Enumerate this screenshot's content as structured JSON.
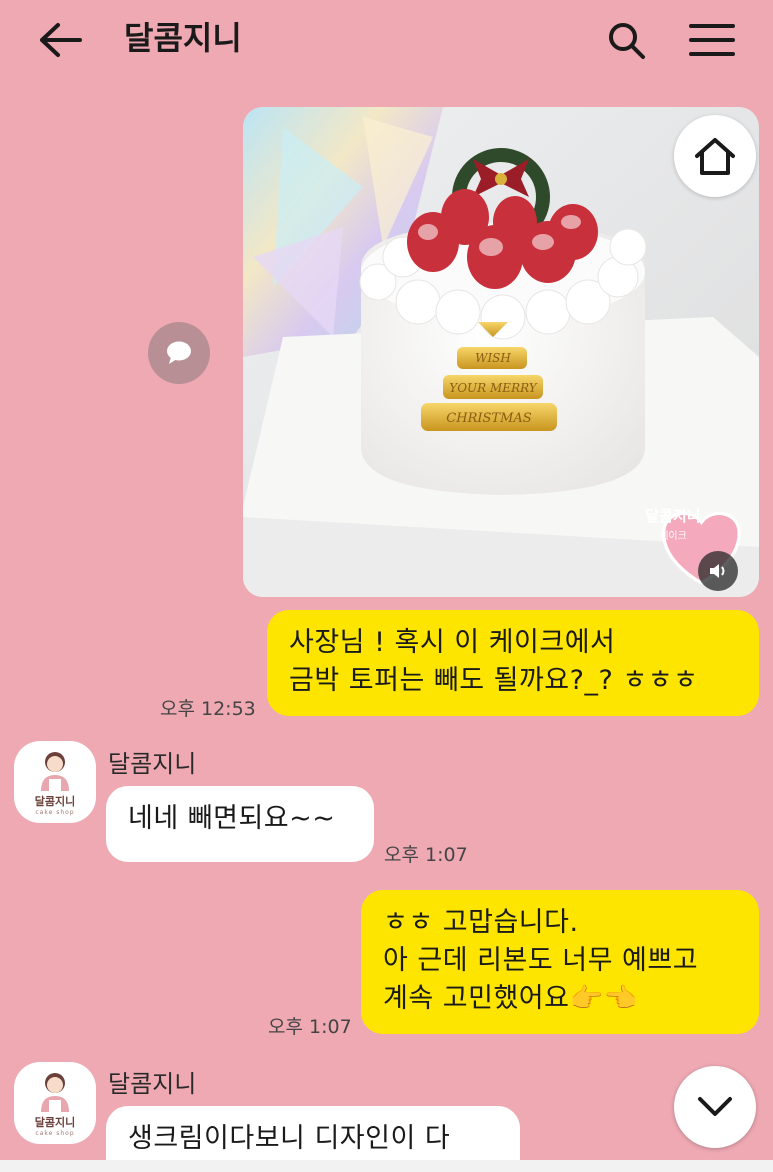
{
  "header": {
    "title": "달콤지니",
    "back_icon": "arrow-left-icon",
    "search_icon": "search-icon",
    "menu_icon": "hamburger-menu-icon"
  },
  "photo": {
    "topper_text": "WISH YOUR MERRY CHRISTMAS",
    "sticker_brand": "달콤지니",
    "sticker_sub": "케이크"
  },
  "messages": [
    {
      "from": "me",
      "text": "사장님 ! 혹시 이 케이크에서\n금박 토퍼는 빼도 될까요?_? ㅎㅎㅎ",
      "time": "오후 12:53"
    },
    {
      "from": "달콤지니",
      "sender_name": "달콤지니",
      "text": "네네 빼면되요~~",
      "time": "오후 1:07"
    },
    {
      "from": "me",
      "text": "ㅎㅎ 고맙습니다.\n아 근데 리본도 너무 예쁘고\n계속 고민했어요👉👈",
      "time": "오후 1:07"
    },
    {
      "from": "달콤지니",
      "sender_name": "달콤지니",
      "text": "생크림이다보니 디자인이 다"
    }
  ],
  "avatar": {
    "brand": "달콤지니",
    "sub": "cake shop"
  },
  "colors": {
    "background": "#eea9b3",
    "my_bubble": "#fee500",
    "their_bubble": "#ffffff"
  }
}
